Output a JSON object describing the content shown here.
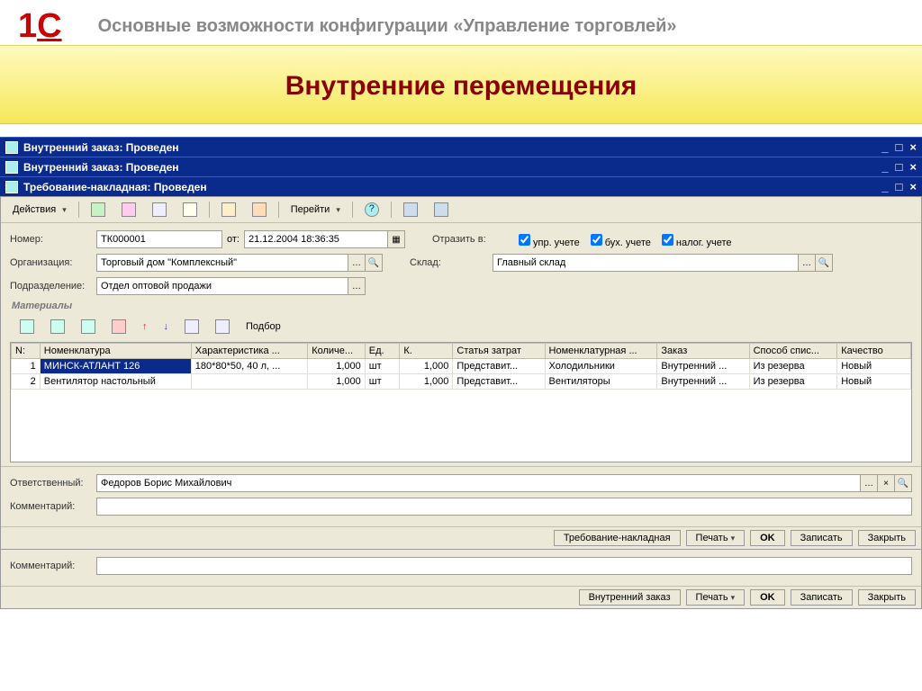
{
  "header": {
    "logo": "1C",
    "subtitle": "Основные возможности конфигурации «Управление торговлей»",
    "banner": "Внутренние перемещения"
  },
  "windows": {
    "bg1_title": "Внутренний заказ: Проведен",
    "bg2_title": "Внутренний заказ: Проведен",
    "main_title": "Требование-накладная: Проведен"
  },
  "toolbar": {
    "actions": "Действия",
    "goto": "Перейти"
  },
  "form": {
    "number_label": "Номер:",
    "number_value": "ТК000001",
    "date_label": "от:",
    "date_value": "21.12.2004 18:36:35",
    "reflect_label": "Отразить в:",
    "chk1": "упр. учете",
    "chk2": "бух. учете",
    "chk3": "налог. учете",
    "org_label": "Организация:",
    "org_value": "Торговый дом \"Комплексный\"",
    "warehouse_label": "Склад:",
    "warehouse_value": "Главный склад",
    "dept_label": "Подразделение:",
    "dept_value": "Отдел оптовой продажи",
    "materials_title": "Материалы",
    "selection": "Подбор",
    "responsible_label": "Ответственный:",
    "responsible_value": "Федоров Борис Михайлович",
    "comment_label": "Комментарий:",
    "comment_value": ""
  },
  "grid": {
    "headers": {
      "num": "N:",
      "nomen": "Номенклатура",
      "char": "Характеристика ...",
      "qty": "Количе...",
      "unit": "Ед.",
      "k": "К.",
      "cost": "Статья затрат",
      "nomgroup": "Номенклатурная ...",
      "order": "Заказ",
      "writeoff": "Способ спис...",
      "quality": "Качество"
    },
    "rows": [
      {
        "num": "1",
        "nomen": "МИНСК-АТЛАНТ 126",
        "char": "180*80*50, 40 л, ...",
        "qty": "1,000",
        "unit": "шт",
        "k": "1,000",
        "cost": "Представит...",
        "nomgroup": "Холодильники",
        "order": "Внутренний ...",
        "writeoff": "Из резерва",
        "quality": "Новый"
      },
      {
        "num": "2",
        "nomen": "Вентилятор настольный",
        "char": "",
        "qty": "1,000",
        "unit": "шт",
        "k": "1,000",
        "cost": "Представит...",
        "nomgroup": "Вентиляторы",
        "order": "Внутренний ...",
        "writeoff": "Из резерва",
        "quality": "Новый"
      }
    ]
  },
  "buttons_inner": {
    "doc": "Требование-накладная",
    "print": "Печать",
    "ok": "OK",
    "save": "Записать",
    "close": "Закрыть"
  },
  "buttons_outer": {
    "doc": "Внутренний заказ",
    "print": "Печать",
    "ok": "OK",
    "save": "Записать",
    "close": "Закрыть"
  },
  "outer_form": {
    "comment_label": "Комментарий:",
    "comment_value": ""
  }
}
